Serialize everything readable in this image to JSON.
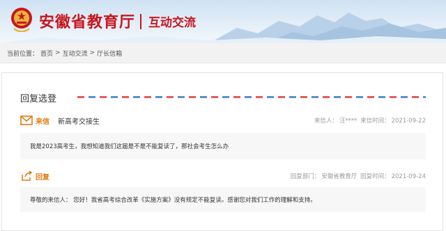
{
  "header": {
    "site_title": "安徽省教育厅",
    "section_title": "互动交流"
  },
  "breadcrumb": {
    "prefix": "当前位置：",
    "items": [
      "首页",
      "互动交流",
      "厅长信箱"
    ],
    "separator": ">"
  },
  "panel": {
    "title": "回复选登"
  },
  "letter": {
    "label": "来信",
    "subject": "新高考交接生",
    "sender_label": "来信人：",
    "sender": "汪****",
    "date_label": "来信时间：",
    "date": "2021-09-22",
    "content": "我是2023高考生，我想知道我们这届是不是不能复读了，那社会考生怎么办"
  },
  "reply": {
    "label": "回复",
    "dept_label": "回复部门：",
    "dept": "安徽省教育厅",
    "date_label": "回复时间：",
    "date": "2021-09-24",
    "content": "尊敬的来信人： 您好！我省高考综合改革《实施方案》没有规定不能复读。感谢您对我们工作的理解和支持。"
  },
  "colors": {
    "brand_red": "#c8161d",
    "accent_orange": "#e07d12"
  }
}
